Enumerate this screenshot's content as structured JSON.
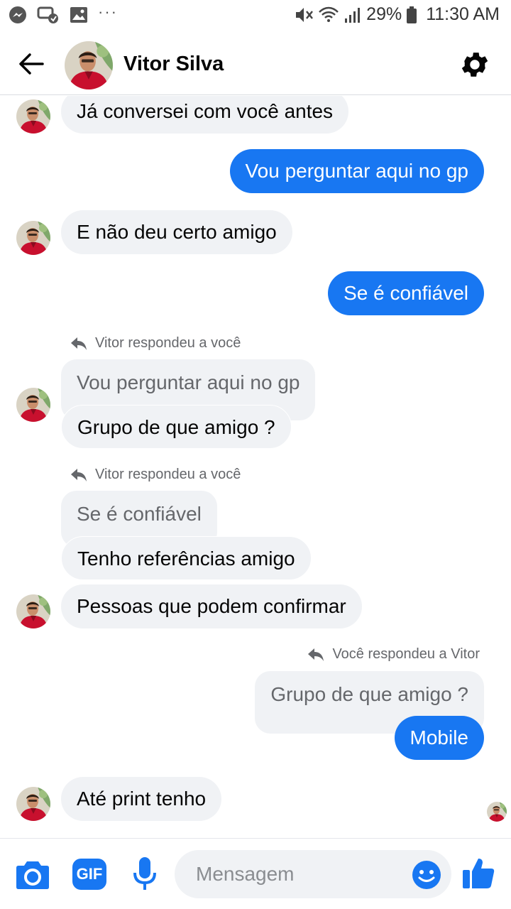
{
  "status_bar": {
    "battery": "29%",
    "time": "11:30 AM",
    "more": "···"
  },
  "header": {
    "contact_name": "Vitor Silva"
  },
  "thread": {
    "m1": "Já conversei com você antes",
    "m2": "Vou perguntar aqui no gp",
    "m3": "E não deu certo amigo",
    "m4": "Se é confiável",
    "r1_note": "Vitor respondeu a você",
    "r1_quote": "Vou perguntar aqui no gp",
    "m5": "Grupo de que amigo ?",
    "r2_note": "Vitor respondeu a você",
    "r2_quote": "Se é confiável",
    "m6": "Tenho referências amigo",
    "m7": "Pessoas que podem confirmar",
    "r3_note": "Você respondeu a Vitor",
    "r3_quote": "Grupo de que amigo ?",
    "m8": "Mobile",
    "m9": "Até print tenho"
  },
  "composer": {
    "placeholder": "Mensagem",
    "gif_label": "GIF"
  },
  "colors": {
    "accent": "#1877f2",
    "incoming_bubble": "#f0f2f5",
    "secondary_text": "#65676b"
  },
  "icons": [
    "messenger-icon",
    "chat-heads-icon",
    "gallery-icon",
    "mute-icon",
    "wifi-icon",
    "signal-icon",
    "battery-icon",
    "back-arrow-icon",
    "gear-icon",
    "reply-icon",
    "camera-icon",
    "gif-icon",
    "microphone-icon",
    "emoji-icon",
    "like-icon"
  ]
}
